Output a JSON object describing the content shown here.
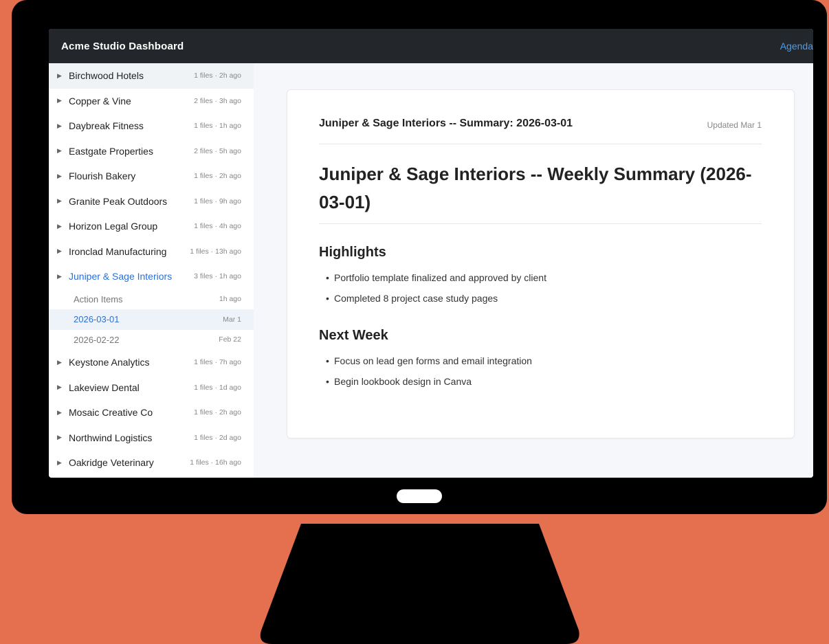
{
  "app": {
    "title": "Acme Studio Dashboard",
    "agenda_link": "Agenda"
  },
  "sidebar": {
    "clients": [
      {
        "name": "Birchwood Hotels",
        "meta": "1 files · 2h ago"
      },
      {
        "name": "Copper & Vine",
        "meta": "2 files · 3h ago"
      },
      {
        "name": "Daybreak Fitness",
        "meta": "1 files · 1h ago"
      },
      {
        "name": "Eastgate Properties",
        "meta": "2 files · 5h ago"
      },
      {
        "name": "Flourish Bakery",
        "meta": "1 files · 2h ago"
      },
      {
        "name": "Granite Peak Outdoors",
        "meta": "1 files · 9h ago"
      },
      {
        "name": "Horizon Legal Group",
        "meta": "1 files · 4h ago"
      },
      {
        "name": "Ironclad Manufacturing",
        "meta": "1 files · 13h ago"
      },
      {
        "name": "Juniper & Sage Interiors",
        "meta": "3 files · 1h ago",
        "selected": true,
        "children": [
          {
            "name": "Action Items",
            "meta": "1h ago"
          },
          {
            "name": "2026-03-01",
            "meta": "Mar 1",
            "selected": true
          },
          {
            "name": "2026-02-22",
            "meta": "Feb 22"
          }
        ]
      },
      {
        "name": "Keystone Analytics",
        "meta": "1 files · 7h ago"
      },
      {
        "name": "Lakeview Dental",
        "meta": "1 files · 1d ago"
      },
      {
        "name": "Mosaic Creative Co",
        "meta": "1 files · 2h ago"
      },
      {
        "name": "Northwind Logistics",
        "meta": "1 files · 2d ago"
      },
      {
        "name": "Oakridge Veterinary",
        "meta": "1 files · 16h ago"
      }
    ],
    "caret_icon": "caret-right-icon"
  },
  "document": {
    "header_title": "Juniper & Sage Interiors -- Summary: 2026-03-01",
    "updated": "Updated Mar 1",
    "heading": "Juniper & Sage Interiors -- Weekly Summary (2026-03-01)",
    "sections": [
      {
        "title": "Highlights",
        "items": [
          "Portfolio template finalized and approved by client",
          "Completed 8 project case study pages"
        ]
      },
      {
        "title": "Next Week",
        "items": [
          "Focus on lead gen forms and email integration",
          "Begin lookbook design in Canva"
        ]
      }
    ]
  },
  "colors": {
    "background": "#e5704f",
    "topbar": "#23272b",
    "accent": "#2b6fd6",
    "link": "#4f9be6"
  }
}
